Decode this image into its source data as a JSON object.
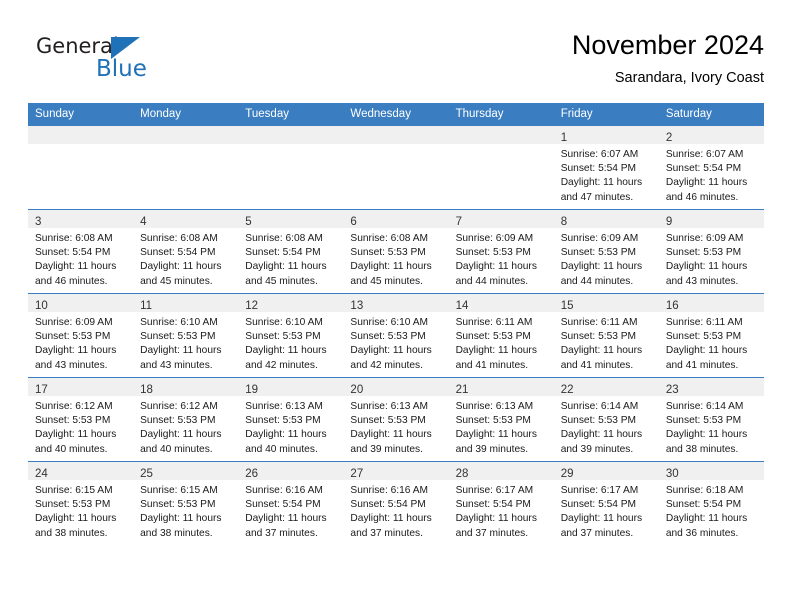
{
  "brand": {
    "name_part1": "General",
    "name_part2": "Blue",
    "accent_color": "#1f71b8"
  },
  "header": {
    "title": "November 2024",
    "subtitle": "Sarandara, Ivory Coast"
  },
  "theme": {
    "header_row_color": "#3a7ec1",
    "day_strip_color": "#f0f0f0",
    "text_color": "#1a1a1a"
  },
  "weekday_headers": [
    "Sunday",
    "Monday",
    "Tuesday",
    "Wednesday",
    "Thursday",
    "Friday",
    "Saturday"
  ],
  "weeks": [
    [
      {
        "day": "",
        "lines": []
      },
      {
        "day": "",
        "lines": []
      },
      {
        "day": "",
        "lines": []
      },
      {
        "day": "",
        "lines": []
      },
      {
        "day": "",
        "lines": []
      },
      {
        "day": "1",
        "lines": [
          "Sunrise: 6:07 AM",
          "Sunset: 5:54 PM",
          "Daylight: 11 hours",
          "and 47 minutes."
        ]
      },
      {
        "day": "2",
        "lines": [
          "Sunrise: 6:07 AM",
          "Sunset: 5:54 PM",
          "Daylight: 11 hours",
          "and 46 minutes."
        ]
      }
    ],
    [
      {
        "day": "3",
        "lines": [
          "Sunrise: 6:08 AM",
          "Sunset: 5:54 PM",
          "Daylight: 11 hours",
          "and 46 minutes."
        ]
      },
      {
        "day": "4",
        "lines": [
          "Sunrise: 6:08 AM",
          "Sunset: 5:54 PM",
          "Daylight: 11 hours",
          "and 45 minutes."
        ]
      },
      {
        "day": "5",
        "lines": [
          "Sunrise: 6:08 AM",
          "Sunset: 5:54 PM",
          "Daylight: 11 hours",
          "and 45 minutes."
        ]
      },
      {
        "day": "6",
        "lines": [
          "Sunrise: 6:08 AM",
          "Sunset: 5:53 PM",
          "Daylight: 11 hours",
          "and 45 minutes."
        ]
      },
      {
        "day": "7",
        "lines": [
          "Sunrise: 6:09 AM",
          "Sunset: 5:53 PM",
          "Daylight: 11 hours",
          "and 44 minutes."
        ]
      },
      {
        "day": "8",
        "lines": [
          "Sunrise: 6:09 AM",
          "Sunset: 5:53 PM",
          "Daylight: 11 hours",
          "and 44 minutes."
        ]
      },
      {
        "day": "9",
        "lines": [
          "Sunrise: 6:09 AM",
          "Sunset: 5:53 PM",
          "Daylight: 11 hours",
          "and 43 minutes."
        ]
      }
    ],
    [
      {
        "day": "10",
        "lines": [
          "Sunrise: 6:09 AM",
          "Sunset: 5:53 PM",
          "Daylight: 11 hours",
          "and 43 minutes."
        ]
      },
      {
        "day": "11",
        "lines": [
          "Sunrise: 6:10 AM",
          "Sunset: 5:53 PM",
          "Daylight: 11 hours",
          "and 43 minutes."
        ]
      },
      {
        "day": "12",
        "lines": [
          "Sunrise: 6:10 AM",
          "Sunset: 5:53 PM",
          "Daylight: 11 hours",
          "and 42 minutes."
        ]
      },
      {
        "day": "13",
        "lines": [
          "Sunrise: 6:10 AM",
          "Sunset: 5:53 PM",
          "Daylight: 11 hours",
          "and 42 minutes."
        ]
      },
      {
        "day": "14",
        "lines": [
          "Sunrise: 6:11 AM",
          "Sunset: 5:53 PM",
          "Daylight: 11 hours",
          "and 41 minutes."
        ]
      },
      {
        "day": "15",
        "lines": [
          "Sunrise: 6:11 AM",
          "Sunset: 5:53 PM",
          "Daylight: 11 hours",
          "and 41 minutes."
        ]
      },
      {
        "day": "16",
        "lines": [
          "Sunrise: 6:11 AM",
          "Sunset: 5:53 PM",
          "Daylight: 11 hours",
          "and 41 minutes."
        ]
      }
    ],
    [
      {
        "day": "17",
        "lines": [
          "Sunrise: 6:12 AM",
          "Sunset: 5:53 PM",
          "Daylight: 11 hours",
          "and 40 minutes."
        ]
      },
      {
        "day": "18",
        "lines": [
          "Sunrise: 6:12 AM",
          "Sunset: 5:53 PM",
          "Daylight: 11 hours",
          "and 40 minutes."
        ]
      },
      {
        "day": "19",
        "lines": [
          "Sunrise: 6:13 AM",
          "Sunset: 5:53 PM",
          "Daylight: 11 hours",
          "and 40 minutes."
        ]
      },
      {
        "day": "20",
        "lines": [
          "Sunrise: 6:13 AM",
          "Sunset: 5:53 PM",
          "Daylight: 11 hours",
          "and 39 minutes."
        ]
      },
      {
        "day": "21",
        "lines": [
          "Sunrise: 6:13 AM",
          "Sunset: 5:53 PM",
          "Daylight: 11 hours",
          "and 39 minutes."
        ]
      },
      {
        "day": "22",
        "lines": [
          "Sunrise: 6:14 AM",
          "Sunset: 5:53 PM",
          "Daylight: 11 hours",
          "and 39 minutes."
        ]
      },
      {
        "day": "23",
        "lines": [
          "Sunrise: 6:14 AM",
          "Sunset: 5:53 PM",
          "Daylight: 11 hours",
          "and 38 minutes."
        ]
      }
    ],
    [
      {
        "day": "24",
        "lines": [
          "Sunrise: 6:15 AM",
          "Sunset: 5:53 PM",
          "Daylight: 11 hours",
          "and 38 minutes."
        ]
      },
      {
        "day": "25",
        "lines": [
          "Sunrise: 6:15 AM",
          "Sunset: 5:53 PM",
          "Daylight: 11 hours",
          "and 38 minutes."
        ]
      },
      {
        "day": "26",
        "lines": [
          "Sunrise: 6:16 AM",
          "Sunset: 5:54 PM",
          "Daylight: 11 hours",
          "and 37 minutes."
        ]
      },
      {
        "day": "27",
        "lines": [
          "Sunrise: 6:16 AM",
          "Sunset: 5:54 PM",
          "Daylight: 11 hours",
          "and 37 minutes."
        ]
      },
      {
        "day": "28",
        "lines": [
          "Sunrise: 6:17 AM",
          "Sunset: 5:54 PM",
          "Daylight: 11 hours",
          "and 37 minutes."
        ]
      },
      {
        "day": "29",
        "lines": [
          "Sunrise: 6:17 AM",
          "Sunset: 5:54 PM",
          "Daylight: 11 hours",
          "and 37 minutes."
        ]
      },
      {
        "day": "30",
        "lines": [
          "Sunrise: 6:18 AM",
          "Sunset: 5:54 PM",
          "Daylight: 11 hours",
          "and 36 minutes."
        ]
      }
    ]
  ]
}
